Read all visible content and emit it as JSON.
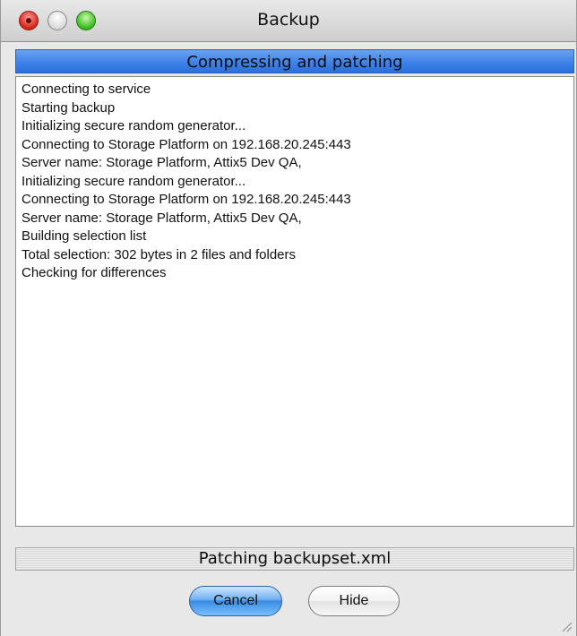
{
  "window": {
    "title": "Backup"
  },
  "header": {
    "status_label": "Compressing and patching"
  },
  "log": {
    "lines": [
      "Connecting to service",
      "Starting backup",
      "Initializing secure random generator...",
      "Connecting to Storage Platform on 192.168.20.245:443",
      "Server name: Storage Platform, Attix5 Dev QA,",
      "Initializing secure random generator...",
      "Connecting to Storage Platform on 192.168.20.245:443",
      "Server name: Storage Platform, Attix5 Dev QA,",
      "Building selection list",
      "Total selection: 302 bytes in 2 files and folders",
      "Checking for differences"
    ]
  },
  "footer": {
    "current_file": "Patching backupset.xml"
  },
  "buttons": {
    "cancel_label": "Cancel",
    "hide_label": "Hide"
  },
  "colors": {
    "header_band": "#3f82e8",
    "default_button": "#3a8be3"
  }
}
